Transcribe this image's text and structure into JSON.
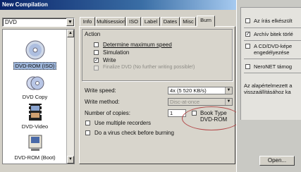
{
  "window": {
    "title": "New Compilation"
  },
  "media_select": {
    "value": "DVD"
  },
  "sidebar": {
    "items": [
      {
        "label": "DVD-ROM (ISO)"
      },
      {
        "label": "DVD Copy"
      },
      {
        "label": "DVD-Video"
      },
      {
        "label": "DVD-ROM (Boot)"
      }
    ]
  },
  "tabs": [
    "Info",
    "Multisession",
    "ISO",
    "Label",
    "Dates",
    "Misc",
    "Burn"
  ],
  "burn": {
    "action_label": "Action",
    "determine_max_speed": "Determine maximum speed",
    "simulation": "Simulation",
    "write": "Write",
    "finalize": "Finalize DVD (No further writing possible!)",
    "write_speed_label": "Write speed:",
    "write_speed_value": "4x (5 520 KB/s)",
    "write_method_label": "Write method:",
    "write_method_value": "Disc-at-once",
    "copies_label": "Number of copies:",
    "copies_value": "1",
    "multiple_recorders": "Use multiple recorders",
    "virus_check": "Do a virus check before burning",
    "book_type_line1": "Book Type",
    "book_type_line2": "DVD-ROM"
  },
  "right_panel": {
    "items": [
      {
        "text": "Az írás elkészült"
      },
      {
        "text": "Archív bitek törlé"
      },
      {
        "text": "A CD/DVD-képe"
      },
      {
        "text": "engedélyezése"
      },
      {
        "text": "NeroNET támog"
      },
      {
        "text": "Az alapértelmezett a"
      },
      {
        "text": "visszaállításához ka"
      }
    ],
    "open_button": "Open..."
  }
}
